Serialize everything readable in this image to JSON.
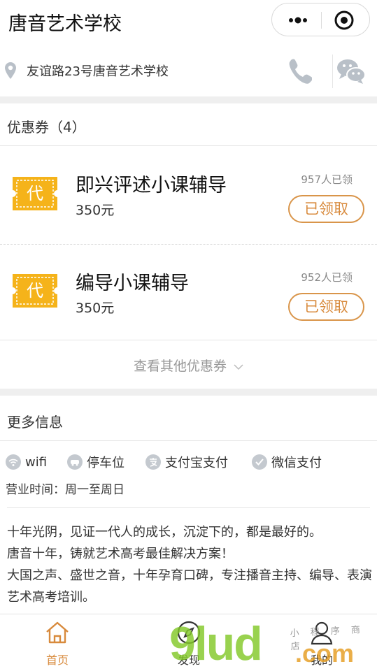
{
  "app": {
    "title": "唐音艺术学校"
  },
  "address": {
    "text": "友谊路23号唐音艺术学校"
  },
  "coupons": {
    "header": "优惠券（4）",
    "ticket_label": "代",
    "items": [
      {
        "name": "即兴评述小课辅导",
        "price": "350元",
        "count": "957人已领",
        "button": "已领取"
      },
      {
        "name": "编导小课辅导",
        "price": "350元",
        "count": "952人已领",
        "button": "已领取"
      }
    ],
    "more_label": "查看其他优惠券"
  },
  "more_info": {
    "header": "更多信息",
    "facilities": [
      {
        "label": "wifi",
        "icon": "wifi-icon"
      },
      {
        "label": "停车位",
        "icon": "parking-icon"
      },
      {
        "label": "支付宝支付",
        "icon": "alipay-icon"
      },
      {
        "label": "微信支付",
        "icon": "wechat-pay-icon"
      }
    ],
    "hours_label": "营业时间：",
    "hours_value": "周一至周日",
    "description": [
      "十年光阴，见证一代人的成长，沉淀下的，都是最好的。",
      "唐音十年，铸就艺术高考最佳解决方案！",
      "大国之声、盛世之音，十年孕育口碑，专注播音主持、编导、表演艺术高考培训。"
    ]
  },
  "tabbar": {
    "items": [
      {
        "label": "首页",
        "icon": "home-icon",
        "active": true
      },
      {
        "label": "发现",
        "icon": "compass-icon",
        "active": false
      },
      {
        "label": "我的",
        "icon": "user-icon",
        "active": false
      }
    ]
  },
  "watermark": {
    "main": "9lud",
    "suffix": ".com",
    "cn": "小 程 序 商 店"
  },
  "colors": {
    "accent": "#d88a3c",
    "ticket": "#f5b31a",
    "icon_gray": "#b9c0c8"
  }
}
